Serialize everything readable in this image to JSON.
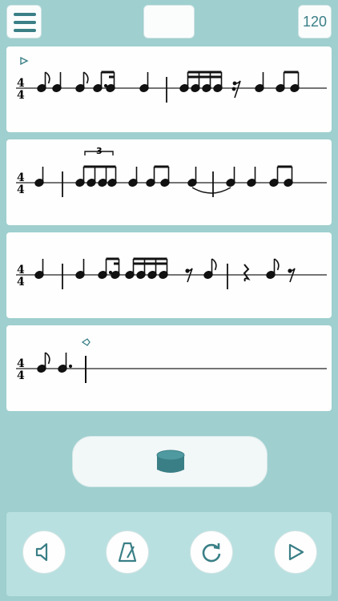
{
  "header": {
    "menu_icon": "hamburger-menu-icon",
    "title": "",
    "tempo": "120"
  },
  "staves": [
    {
      "time_signature": {
        "top": "4",
        "bottom": "4"
      },
      "marker": "play-start-marker"
    },
    {
      "time_signature": {
        "top": "4",
        "bottom": "4"
      },
      "tuplet": "3"
    },
    {
      "time_signature": {
        "top": "4",
        "bottom": "4"
      }
    },
    {
      "time_signature": {
        "top": "4",
        "bottom": "4"
      },
      "marker": "play-end-marker"
    }
  ],
  "record_pad": {
    "icon": "drum-icon"
  },
  "controls": [
    {
      "name": "mute",
      "icon": "speaker-icon"
    },
    {
      "name": "metronome",
      "icon": "metronome-icon"
    },
    {
      "name": "loop",
      "icon": "loop-icon"
    },
    {
      "name": "play",
      "icon": "play-icon"
    }
  ],
  "colors": {
    "background": "#9fcfcf",
    "accent": "#3a7f86",
    "control_bar": "#b9e0e0",
    "card": "#fefefe"
  }
}
